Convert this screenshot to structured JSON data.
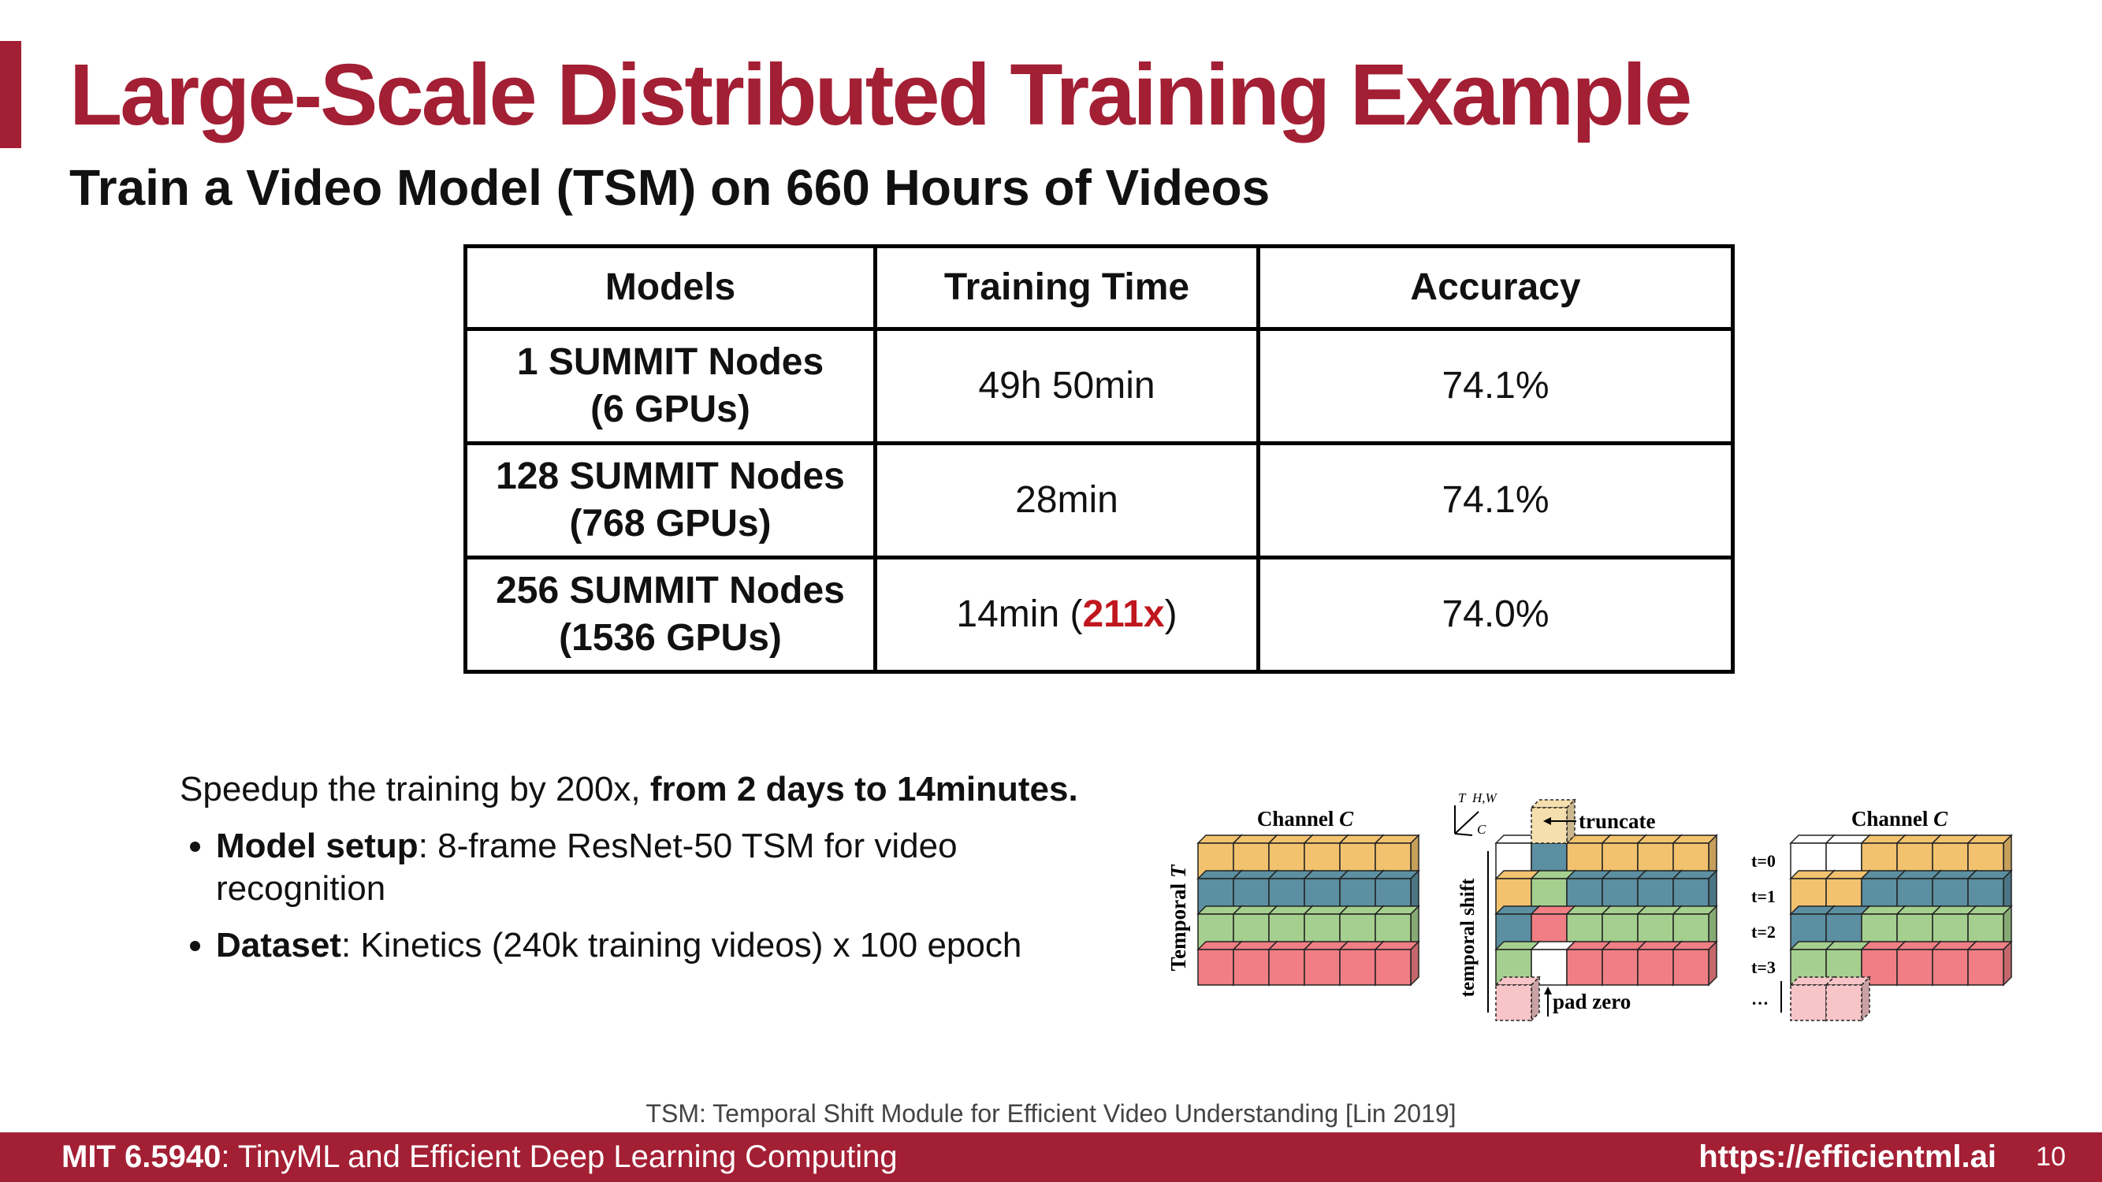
{
  "slide": {
    "title": "Large-Scale Distributed Training Example",
    "subtitle": "Train a Video Model (TSM) on 660 Hours of Videos"
  },
  "table": {
    "headers": [
      "Models",
      "Training Time",
      "Accuracy"
    ],
    "rows": [
      {
        "model_line1": "1 SUMMIT Nodes",
        "model_line2": "(6 GPUs)",
        "time": "49h 50min",
        "time_prefix": "",
        "time_highlight": "",
        "time_suffix": "",
        "accuracy": "74.1%"
      },
      {
        "model_line1": "128 SUMMIT Nodes",
        "model_line2": "(768 GPUs)",
        "time": "28min",
        "time_prefix": "",
        "time_highlight": "",
        "time_suffix": "",
        "accuracy": "74.1%"
      },
      {
        "model_line1": "256 SUMMIT Nodes",
        "model_line2": "(1536 GPUs)",
        "time": "",
        "time_prefix": "14min (",
        "time_highlight": "211x",
        "time_suffix": ")",
        "accuracy": "74.0%"
      }
    ]
  },
  "summary": {
    "intro_plain": "Speedup the training by 200x, ",
    "intro_bold": "from 2 days to 14minutes.",
    "bullets": [
      {
        "label": "Model setup",
        "text": ": 8-frame ResNet-50 TSM for video recognition"
      },
      {
        "label": "Dataset",
        "text": ": Kinetics (240k training videos) x 100 epoch"
      }
    ]
  },
  "figure": {
    "channel_label": "Channel",
    "channel_var": "C",
    "temporal_label": "Temporal",
    "temporal_var": "T",
    "temporal_shift_label": "temporal shift",
    "truncate_label": "truncate",
    "pad_zero_label": "pad zero",
    "axis_t": "T",
    "axis_hw": "H,W",
    "axis_c": "C",
    "time_labels": [
      "t=0",
      "t=1",
      "t=2",
      "t=3",
      "…"
    ],
    "colors": {
      "orange": "#f2c26f",
      "teal": "#5b8fa1",
      "green": "#a5cf8e",
      "red": "#f07e84",
      "pad": "#f7c5c8",
      "truncated": "#f6dfae"
    }
  },
  "citation": "TSM: Temporal Shift Module for Efficient Video Understanding [Lin 2019]",
  "footer": {
    "course_bold": "MIT 6.5940",
    "course_rest": ": TinyML and Efficient Deep Learning Computing",
    "url": "https://efficientml.ai",
    "page_number": "10"
  },
  "theme": {
    "accent": "#a31f34",
    "highlight": "#c0171e"
  }
}
